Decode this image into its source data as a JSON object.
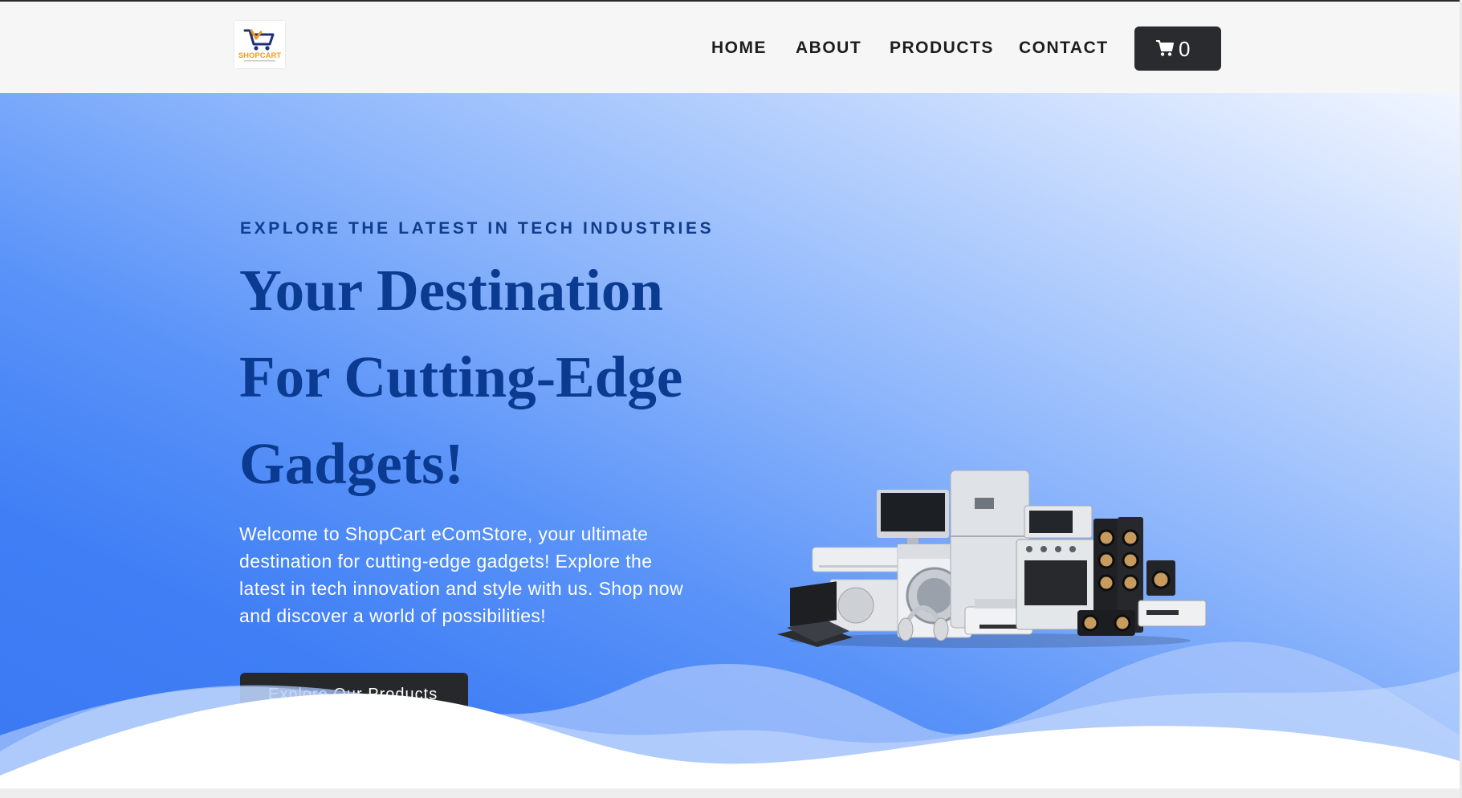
{
  "header": {
    "logo": {
      "brand_text": "SHOPCART",
      "icon": "shopping-cart-logo-icon"
    },
    "nav": {
      "home": "HOME",
      "about": "ABOUT",
      "products": "PRODUCTS",
      "contact": "CONTACT"
    },
    "cart": {
      "icon": "shopping-cart-icon",
      "count": "0"
    }
  },
  "hero": {
    "eyebrow": "EXPLORE THE LATEST IN TECH INDUSTRIES",
    "headline": {
      "line1": "Your Destination",
      "line2": "For Cutting-Edge",
      "line3": "Gadgets!"
    },
    "intro": "Welcome to ShopCart eComStore, your ultimate destination for cutting-edge gadgets! Explore the latest in tech innovation and style with us. Shop now and discover a world of possibilities!",
    "cta_label": "Explore Our Products",
    "image": "home-appliances-and-electronics-image"
  },
  "colors": {
    "header_bg": "#f6f6f6",
    "nav_text": "#1d1d1d",
    "dark_button": "#2a2b2e",
    "heading_blue": "#0b3a91",
    "eyebrow_blue": "#0f3d8c",
    "hero_gradient_light": "#f2f6ff",
    "hero_gradient_dark": "#3b79f2",
    "logo_orange": "#f29a1f",
    "logo_navy": "#1e2f7a"
  }
}
